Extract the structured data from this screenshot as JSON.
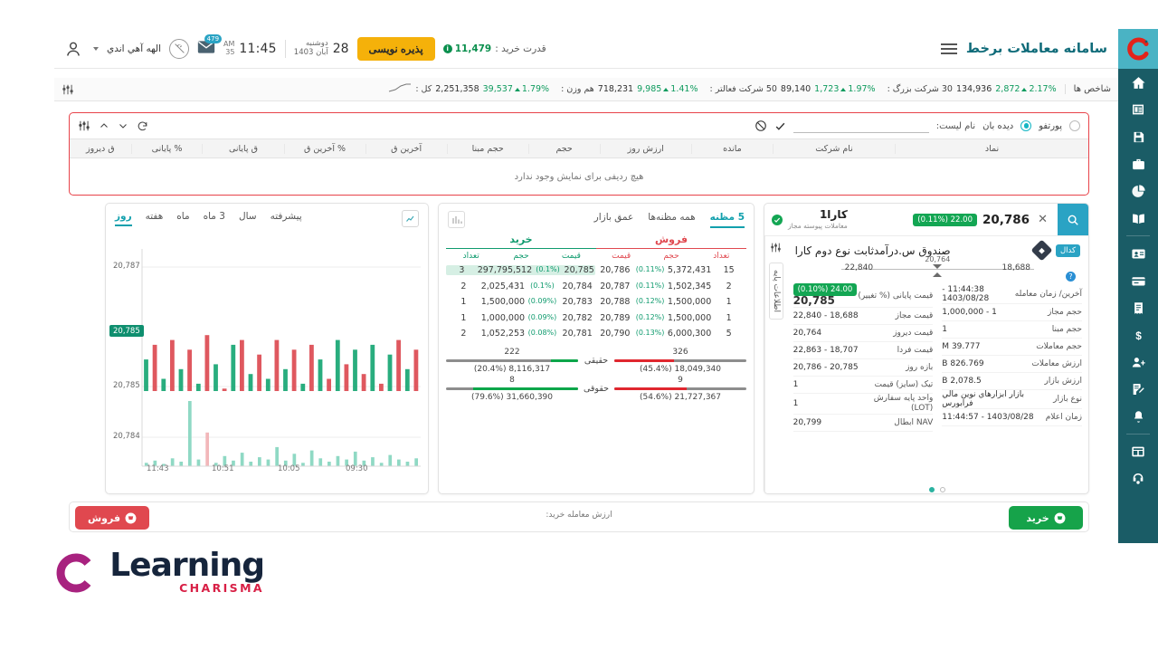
{
  "header": {
    "brand_title": "سامانه معاملات برخط",
    "menu_icon": "hamburger-icon",
    "logo_icon": "charisma-logo-icon",
    "buy_power_label": "قدرت خرید :",
    "buy_power_value": "11,479",
    "register_button": "پذیره نویسی",
    "date_day": "28",
    "date_weekday": "دوشنبه",
    "date_month": "آبان 1403",
    "time": "11:45",
    "ampm_1": "AM",
    "ampm_2": "35",
    "mail_badge": "479",
    "mail_icon": "mail-icon",
    "plug_icon": "plug-disconnected-icon",
    "user_name": "الهه آهي اندي",
    "user_icon": "user-avatar-icon"
  },
  "index_bar": {
    "label": "شاخص ها",
    "settings_icon": "sliders-icon",
    "items": [
      {
        "name": "کل :",
        "value": "2,251,358",
        "change": "39,537",
        "percent": "1.79%",
        "spark": "sparkline-icon"
      },
      {
        "name": "هم وزن :",
        "value": "718,231",
        "change": "9,985",
        "percent": "1.41%"
      },
      {
        "name": "50 شرکت فعالتر :",
        "value": "89,140",
        "change": "1,723",
        "percent": "1.97%"
      },
      {
        "name": "30 شرکت بزرگ :",
        "value": "134,936",
        "change": "2,872",
        "percent": "2.17%"
      }
    ]
  },
  "watchlist": {
    "portfolio_label": "پورتفو",
    "watch_label": "دیده بان",
    "list_name_label": "نام لیست:",
    "list_name_value": "",
    "check_icon": "check-icon",
    "block_icon": "block-icon",
    "settings_icon": "sliders-icon",
    "chevron_up_icon": "chevron-up-icon",
    "chevron_down_icon": "chevron-down-icon",
    "refresh_icon": "refresh-icon",
    "columns": [
      "نماد",
      "نام شرکت",
      "مانده",
      "ارزش روز",
      "حجم",
      "حجم مبنا",
      "آخرین ق",
      "% آخرین ق",
      "ق پایانی",
      "% پایانی",
      "ق دیروز"
    ],
    "empty_text": "هیچ ردیفی برای نمایش وجود ندارد"
  },
  "chart": {
    "tabs": [
      {
        "label": "روز",
        "active": true
      },
      {
        "label": "هفته",
        "active": false
      },
      {
        "label": "ماه",
        "active": false
      },
      {
        "label": "3 ماه",
        "active": false
      },
      {
        "label": "سال",
        "active": false
      },
      {
        "label": "پیشرفته",
        "active": false
      }
    ],
    "chart_icon": "line-chart-icon",
    "y_labels": [
      "20,787",
      "20,785",
      "20,784"
    ],
    "price_badge": "20,785",
    "x_labels": [
      "09:30",
      "10:05",
      "10:51",
      "11:43"
    ]
  },
  "chart_data": {
    "type": "line",
    "title": "",
    "xlabel": "",
    "ylabel": "",
    "ylim": [
      20784,
      20787.5
    ],
    "ytick_labels": [
      "20,787",
      "20,785",
      "20,784"
    ],
    "xtick_labels": [
      "09:30",
      "10:05",
      "10:51",
      "11:43"
    ],
    "current_price": 20785,
    "grid": true,
    "legend": "none",
    "series": [
      {
        "name": "price",
        "note": "dense intraday up/down vertical tick bars between 20,785 and 20,786",
        "values": [
          20785.6,
          20785.9,
          20785.2,
          20786.0,
          20785.4,
          20785.8,
          20785.1,
          20786.1,
          20785.5,
          20785.0,
          20785.9,
          20786.0,
          20785.3,
          20785.7,
          20785.2,
          20786.0,
          20785.4,
          20785.8,
          20785.1,
          20785.9,
          20785.6,
          20785.2,
          20786.0,
          20785.5,
          20785.8,
          20785.3,
          20785.9,
          20785.1,
          20785.7,
          20786.0,
          20785.4,
          20785.8
        ]
      },
      {
        "name": "volume",
        "note": "volume bars along bottom axis, teal for buy dominant, pink for sell",
        "values": [
          3,
          5,
          2,
          7,
          4,
          58,
          6,
          30,
          3,
          9,
          5,
          12,
          4,
          8,
          6,
          17,
          5,
          11,
          3,
          14,
          7,
          4,
          9,
          6,
          13,
          5,
          8,
          3,
          10,
          6,
          4,
          7
        ]
      }
    ]
  },
  "orderbook": {
    "tabs": [
      {
        "label": "5 مظنه",
        "active": true
      },
      {
        "label": "همه مظنه‌ها",
        "active": false
      },
      {
        "label": "عمق بازار",
        "active": false
      }
    ],
    "grid_icon": "grid-chart-icon",
    "buy_title": "خرید",
    "sell_title": "فروش",
    "buy_cols": [
      "تعداد",
      "حجم",
      "قیمت"
    ],
    "sell_cols": [
      "قیمت",
      "حجم",
      "تعداد"
    ],
    "buy_rows": [
      {
        "count": "3",
        "volume": "297,795,512",
        "pct": "(0.1%)",
        "price": "20,785"
      },
      {
        "count": "2",
        "volume": "2,025,431",
        "pct": "(0.1%)",
        "price": "20,784"
      },
      {
        "count": "1",
        "volume": "1,500,000",
        "pct": "(0.09%)",
        "price": "20,783"
      },
      {
        "count": "1",
        "volume": "1,000,000",
        "pct": "(0.09%)",
        "price": "20,782"
      },
      {
        "count": "2",
        "volume": "1,052,253",
        "pct": "(0.08%)",
        "price": "20,781"
      }
    ],
    "sell_rows": [
      {
        "price": "20,786",
        "pct": "(0.11%)",
        "volume": "5,372,431",
        "count": "15"
      },
      {
        "price": "20,787",
        "pct": "(0.11%)",
        "volume": "1,502,345",
        "count": "2"
      },
      {
        "price": "20,788",
        "pct": "(0.12%)",
        "volume": "1,500,000",
        "count": "1"
      },
      {
        "price": "20,789",
        "pct": "(0.12%)",
        "volume": "1,500,000",
        "count": "1"
      },
      {
        "price": "20,790",
        "pct": "(0.13%)",
        "volume": "6,000,300",
        "count": "5"
      }
    ],
    "stats": {
      "real_label": "حقیقی",
      "legal_label": "حقوقی",
      "real_buy_count": "222",
      "real_buy_value": "8,116,317 (20.4%)",
      "real_buy_pct": 20.4,
      "real_sell_count": "326",
      "real_sell_value": "18,049,340 (45.4%)",
      "real_sell_pct": 45.4,
      "legal_buy_count": "8",
      "legal_buy_value": "31,660,390 (79.6%)",
      "legal_buy_pct": 79.6,
      "legal_sell_count": "9",
      "legal_sell_value": "21,727,367 (54.6%)",
      "legal_sell_pct": 54.6
    }
  },
  "symbol": {
    "search_icon": "search-icon",
    "name": "کارا1",
    "sub": "معاملات پیوسته   مجاز",
    "verified_icon": "verified-check-icon",
    "price": "20,786",
    "change_badge": "22.00 (0.11%)",
    "close_icon": "close-icon",
    "settings_icon": "sliders-icon",
    "rail_tab": "اطلاعات پایه",
    "fund_name": "صندوق س.درآمدثابت نوع دوم کارا",
    "fund_tag": "کدال",
    "fund_diamond_icon": "diamond-icon",
    "range_min": "18,688",
    "range_max": "22,840",
    "range_marker": "20,764",
    "help_icon": "help-circle-icon",
    "left_rows": [
      {
        "key": "آخرین/ زمان معامله",
        "value": "11:44:38 - 1403/08/28"
      },
      {
        "key": "حجم مجاز",
        "value": "1 - 1,000,000"
      },
      {
        "key": "حجم مبنا",
        "value": "1"
      },
      {
        "key": "حجم معاملات",
        "value": "39.777 M"
      },
      {
        "key": "ارزش معاملات",
        "value": "826.769 B"
      },
      {
        "key": "ارزش بازار",
        "value": "2,078.5 B"
      },
      {
        "key": "نوع بازار",
        "value": "بازار ابزارهاي نوين مالي فرابورس"
      },
      {
        "key": "زمان اعلام",
        "value": "1403/08/28 - 11:44:57"
      }
    ],
    "right_rows": [
      {
        "key": "قیمت پایانی (% تغییر)",
        "value": "20,785",
        "badge": "24.00 (0.10%)",
        "big": true
      },
      {
        "key": "قیمت مجاز",
        "value": "18,688 - 22,840"
      },
      {
        "key": "قیمت دیروز",
        "value": "20,764"
      },
      {
        "key": "قیمت فردا",
        "value": "18,707 - 22,863"
      },
      {
        "key": "بازه روز",
        "value": "20,785 - 20,786"
      },
      {
        "key": "تیک (سایز) قیمت",
        "value": "1"
      },
      {
        "key": "واحد پایه سفارش (LOT)",
        "value": "1"
      },
      {
        "key": "NAV ابطال",
        "value": "20,799"
      }
    ]
  },
  "bottom_bar": {
    "buy_label": "خرید",
    "sell_label": "فروش",
    "value_label": "ارزش معامله خرید:"
  },
  "sidebar": {
    "items": [
      {
        "icon": "home-icon",
        "name": "sidebar-item-home"
      },
      {
        "icon": "list-icon",
        "name": "sidebar-item-orders"
      },
      {
        "icon": "save-icon",
        "name": "sidebar-item-archive"
      },
      {
        "icon": "briefcase-icon",
        "name": "sidebar-item-portfolio"
      },
      {
        "icon": "pie-chart-icon",
        "name": "sidebar-item-reports"
      },
      {
        "icon": "book-icon",
        "name": "sidebar-item-education"
      },
      {
        "icon": "id-card-icon",
        "name": "sidebar-item-profile"
      },
      {
        "icon": "credit-card-icon",
        "name": "sidebar-item-payments"
      },
      {
        "icon": "receipt-icon",
        "name": "sidebar-item-statements"
      },
      {
        "icon": "dollar-icon",
        "name": "sidebar-item-funds"
      },
      {
        "icon": "user-plus-icon",
        "name": "sidebar-item-add-user"
      },
      {
        "icon": "edit-doc-icon",
        "name": "sidebar-item-requests"
      },
      {
        "icon": "bell-icon",
        "name": "sidebar-item-notifications"
      },
      {
        "icon": "apps-icon",
        "name": "sidebar-item-apps"
      },
      {
        "icon": "headset-icon",
        "name": "sidebar-item-support"
      }
    ]
  },
  "learning_logo": {
    "main": "Learning",
    "sub": "CHARISMA",
    "icon": "charisma-c-icon",
    "accent": "#a8227f"
  },
  "colors": {
    "brand_teal": "#1a5c66",
    "accent_cyan": "#2aa3c4",
    "up_green": "#0f9b6e",
    "down_red": "#e0484f",
    "highlight_red": "#e8434a",
    "yellow": "#f5b10a"
  }
}
